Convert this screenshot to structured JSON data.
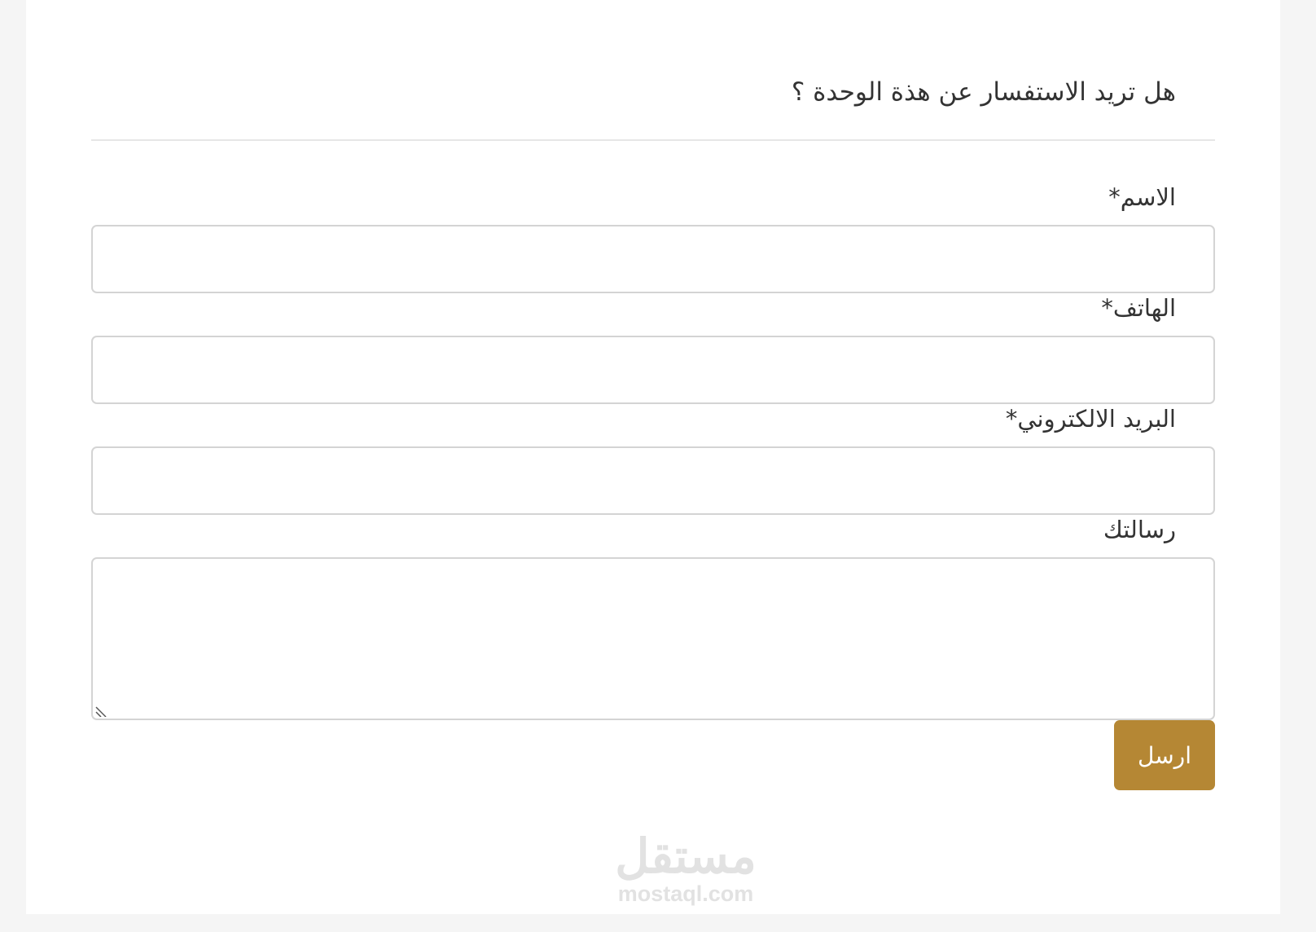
{
  "form": {
    "title": "هل تريد الاستفسار عن هذة الوحدة ؟",
    "fields": [
      {
        "label": "الاسم*",
        "value": ""
      },
      {
        "label": "الهاتف*",
        "value": ""
      },
      {
        "label": "البريد الالكتروني*",
        "value": ""
      },
      {
        "label": "رسالتك",
        "value": ""
      }
    ],
    "submit_label": "ارسل"
  },
  "watermark": {
    "arabic": "مستقل",
    "domain": "mostaql.com"
  },
  "colors": {
    "accent": "#b58734",
    "page_background": "#f5f5f5",
    "card_background": "#ffffff",
    "border": "#d4d4d4",
    "text": "#333333"
  }
}
